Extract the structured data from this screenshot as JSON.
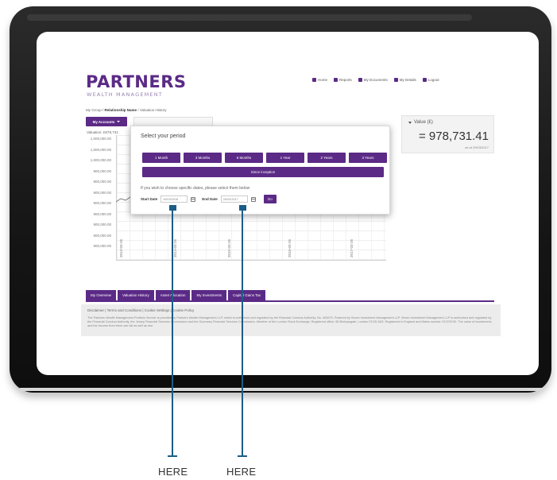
{
  "site": {
    "logo_main": "PARTNERS",
    "logo_sub": "WEALTH MANAGEMENT",
    "topnav": [
      {
        "label": "Home",
        "icon": "home-icon"
      },
      {
        "label": "Reports",
        "icon": "reports-icon"
      },
      {
        "label": "My Documents",
        "icon": "documents-icon"
      },
      {
        "label": "My Details",
        "icon": "user-icon"
      },
      {
        "label": "Logout",
        "icon": "logout-icon"
      }
    ],
    "breadcrumb": {
      "part1": "My Group",
      "part2": "Relationship Name",
      "part3": "Valuation History"
    },
    "accounts_button": "My Accounts",
    "chart_top_label": "Valuation: £978,731",
    "y_ticks": [
      "1,000,000.00",
      "1,000,000.00",
      "1,000,000.00",
      "900,000.00",
      "900,000.00",
      "900,000.00",
      "900,000.00",
      "900,000.00",
      "900,000.00",
      "900,000.00",
      "900,000.00"
    ],
    "x_ticks": [
      "2013-03-26",
      "2014-03-26",
      "2015-03-26",
      "2016-03-26",
      "2017-03-26"
    ]
  },
  "value_panel": {
    "label": "Value (£)",
    "amount": "= 978,731.41",
    "as_of": "as at 29/03/2017"
  },
  "modal": {
    "title": "Select your period",
    "periods": [
      "1 Month",
      "3 Months",
      "6 Months",
      "1 Year",
      "2 Years",
      "3 Years"
    ],
    "since_inception": "Since inception",
    "hint": "If you wish to choose specific dates, please select them below",
    "start_label": "Start Date",
    "start_value": "26/03/2016",
    "end_label": "End Date",
    "end_value": "26/03/2017",
    "go_label": "Go"
  },
  "bottom_tabs": [
    "My Overview",
    "Valuation History",
    "Asset Allocation",
    "My Investments",
    "Capital Gains Tax"
  ],
  "footer": {
    "links": "Disclaimer  |  Terms and Conditions  |  Cookie Settings  |  Cookie Policy",
    "text": "The Partners Wealth Management Portfolio Service is provided by Partners Wealth Management LLP, which is authorised and regulated by the Financial Conduct Authority. No. 453970. Powered by Seven Investment Management LLP. Seven Investment Management LLP is authorised and regulated by the Financial Conduct Authority, the Jersey Financial Services Commission and the Guernsey Financial Services Commission. Member of the London Stock Exchange. Registered office: 55 Bishopsgate, London EC2N 3AS. Registered in England and Wales number OC378740. The value of investments and the income from them can fall as well as rise."
  },
  "annotations": {
    "left": "HERE",
    "right": "HERE",
    "color": "#1b5d87"
  },
  "colors": {
    "brand": "#5b2a86"
  }
}
